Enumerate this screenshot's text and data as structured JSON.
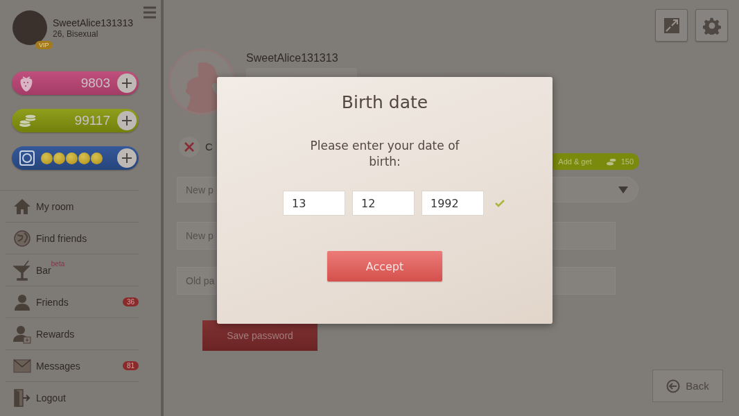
{
  "profile": {
    "username": "SweetAlice131313",
    "details": "26, Bisexual",
    "badge": "VIP"
  },
  "currencies": [
    {
      "kind": "strawberries",
      "amount": "9803"
    },
    {
      "kind": "coins",
      "amount": "99117"
    },
    {
      "kind": "condoms",
      "stars": 5
    }
  ],
  "menu": [
    {
      "kind": "house",
      "label": "My room"
    },
    {
      "kind": "globe",
      "label": "Find friends"
    },
    {
      "kind": "cocktail",
      "label": "Bar",
      "tag": "beta"
    },
    {
      "kind": "person",
      "label": "Friends",
      "count": "36"
    },
    {
      "kind": "reward",
      "label": "Rewards"
    },
    {
      "kind": "envelope",
      "label": "Messages",
      "count": "81"
    },
    {
      "kind": "door",
      "label": "Logout"
    }
  ],
  "profile_panel": {
    "username": "SweetAlice131313",
    "cancel_label": "C",
    "bonus": {
      "label": "Add & get",
      "amount": "150"
    },
    "fields": [
      {
        "kind": "dropdown",
        "placeholder": "New p"
      },
      {
        "kind": "text",
        "placeholder": "New p"
      },
      {
        "kind": "text",
        "placeholder": "Old pa"
      }
    ],
    "save_button": "Save password",
    "back_button": "Back"
  },
  "dialog": {
    "title": "Birth date",
    "prompt": "Please enter your date of birth:",
    "fields": [
      {
        "value": "13"
      },
      {
        "value": "12"
      },
      {
        "value": "1992"
      }
    ],
    "valid": true,
    "button": "Accept"
  }
}
